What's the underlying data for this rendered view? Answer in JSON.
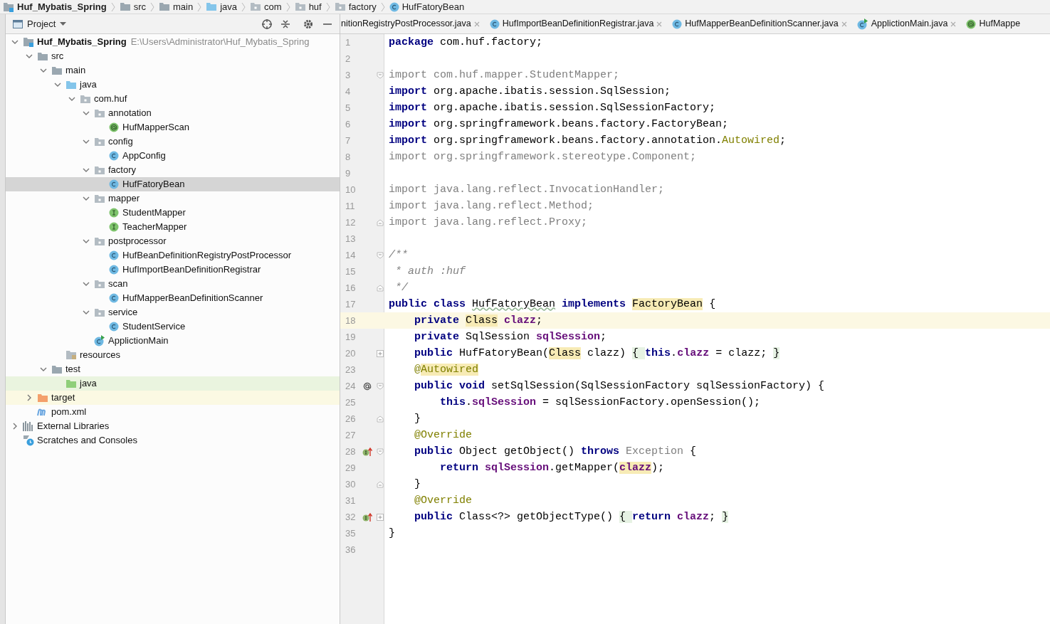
{
  "breadcrumb": [
    {
      "label": "Huf_Mybatis_Spring",
      "kind": "project"
    },
    {
      "label": "src",
      "kind": "folder"
    },
    {
      "label": "main",
      "kind": "folder"
    },
    {
      "label": "java",
      "kind": "src-folder"
    },
    {
      "label": "com",
      "kind": "package"
    },
    {
      "label": "huf",
      "kind": "package"
    },
    {
      "label": "factory",
      "kind": "package"
    },
    {
      "label": "HufFatoryBean",
      "kind": "class"
    }
  ],
  "project_panel": {
    "title": "Project",
    "tree": [
      {
        "label": "Huf_Mybatis_Spring",
        "path": "E:\\Users\\Administrator\\Huf_Mybatis_Spring",
        "kind": "project",
        "expanded": true,
        "selected": false,
        "children": [
          {
            "label": "src",
            "kind": "folder",
            "expanded": true,
            "selected": false,
            "children": [
              {
                "label": "main",
                "kind": "folder",
                "expanded": true,
                "selected": false,
                "children": [
                  {
                    "label": "java",
                    "kind": "src-folder",
                    "expanded": true,
                    "selected": false,
                    "children": [
                      {
                        "label": "com.huf",
                        "kind": "package",
                        "expanded": true,
                        "selected": false,
                        "children": [
                          {
                            "label": "annotation",
                            "kind": "package",
                            "expanded": true,
                            "selected": false,
                            "children": [
                              {
                                "label": "HufMapperScan",
                                "kind": "annotation",
                                "selected": false
                              }
                            ]
                          },
                          {
                            "label": "config",
                            "kind": "package",
                            "expanded": true,
                            "selected": false,
                            "children": [
                              {
                                "label": "AppConfig",
                                "kind": "class",
                                "selected": false
                              }
                            ]
                          },
                          {
                            "label": "factory",
                            "kind": "package",
                            "expanded": true,
                            "selected": false,
                            "children": [
                              {
                                "label": "HufFatoryBean",
                                "kind": "class",
                                "selected": true
                              }
                            ]
                          },
                          {
                            "label": "mapper",
                            "kind": "package",
                            "expanded": true,
                            "selected": false,
                            "children": [
                              {
                                "label": "StudentMapper",
                                "kind": "interface",
                                "selected": false
                              },
                              {
                                "label": "TeacherMapper",
                                "kind": "interface",
                                "selected": false
                              }
                            ]
                          },
                          {
                            "label": "postprocessor",
                            "kind": "package",
                            "expanded": true,
                            "selected": false,
                            "children": [
                              {
                                "label": "HufBeanDefinitionRegistryPostProcessor",
                                "kind": "class",
                                "selected": false
                              },
                              {
                                "label": "HufImportBeanDefinitionRegistrar",
                                "kind": "class",
                                "selected": false
                              }
                            ]
                          },
                          {
                            "label": "scan",
                            "kind": "package",
                            "expanded": true,
                            "selected": false,
                            "children": [
                              {
                                "label": "HufMapperBeanDefinitionScanner",
                                "kind": "class",
                                "selected": false
                              }
                            ]
                          },
                          {
                            "label": "service",
                            "kind": "package",
                            "expanded": true,
                            "selected": false,
                            "children": [
                              {
                                "label": "StudentService",
                                "kind": "class",
                                "selected": false
                              }
                            ]
                          },
                          {
                            "label": "ApplictionMain",
                            "kind": "main-class",
                            "selected": false
                          }
                        ]
                      }
                    ]
                  },
                  {
                    "label": "resources",
                    "kind": "resources",
                    "selected": false
                  }
                ]
              },
              {
                "label": "test",
                "kind": "folder",
                "expanded": true,
                "selected": false,
                "children": [
                  {
                    "label": "java",
                    "kind": "test-folder",
                    "selected": false
                  }
                ]
              }
            ]
          },
          {
            "label": "target",
            "kind": "excluded",
            "expanded": false,
            "selected": false
          },
          {
            "label": "pom.xml",
            "kind": "maven",
            "selected": false
          }
        ]
      },
      {
        "label": "External Libraries",
        "kind": "libraries",
        "expanded": false,
        "selected": false
      },
      {
        "label": "Scratches and Consoles",
        "kind": "scratches",
        "selected": false
      }
    ]
  },
  "tabs": [
    {
      "label": "nitionRegistryPostProcessor.java",
      "kind": "partial",
      "closable": true
    },
    {
      "label": "HufImportBeanDefinitionRegistrar.java",
      "kind": "class",
      "closable": true
    },
    {
      "label": "HufMapperBeanDefinitionScanner.java",
      "kind": "class",
      "closable": true
    },
    {
      "label": "ApplictionMain.java",
      "kind": "main-class",
      "closable": true
    },
    {
      "label": "HufMappe",
      "kind": "annotation",
      "closable": false
    }
  ],
  "editor": {
    "lines": [
      {
        "number": "1",
        "kind": "plain",
        "current": false,
        "tokens": [
          {
            "text": "package",
            "kind": "kw"
          },
          {
            "text": " com.huf.factory;",
            "kind": "plain"
          }
        ]
      },
      {
        "number": "2",
        "kind": "plain",
        "current": false
      },
      {
        "number": "3",
        "kind": "fold-start",
        "current": false,
        "tokens": [
          {
            "text": "import com.huf.mapper.StudentMapper;",
            "kind": "unused"
          }
        ]
      },
      {
        "number": "4",
        "kind": "plain",
        "current": false,
        "tokens": [
          {
            "text": "import",
            "kind": "kw"
          },
          {
            "text": " org.apache.ibatis.session.SqlSession;",
            "kind": "plain"
          }
        ]
      },
      {
        "number": "5",
        "kind": "plain",
        "current": false,
        "tokens": [
          {
            "text": "import",
            "kind": "kw"
          },
          {
            "text": " org.apache.ibatis.session.SqlSessionFactory;",
            "kind": "plain"
          }
        ]
      },
      {
        "number": "6",
        "kind": "plain",
        "current": false,
        "tokens": [
          {
            "text": "import",
            "kind": "kw"
          },
          {
            "text": " org.springframework.beans.factory.FactoryBean;",
            "kind": "plain"
          }
        ]
      },
      {
        "number": "7",
        "kind": "plain",
        "current": false,
        "tokens": [
          {
            "text": "import",
            "kind": "kw"
          },
          {
            "text": " org.springframework.beans.factory.annotation.",
            "kind": "plain"
          },
          {
            "text": "Autowired",
            "kind": "annot"
          },
          {
            "text": ";",
            "kind": "plain"
          }
        ]
      },
      {
        "number": "8",
        "kind": "plain",
        "current": false,
        "tokens": [
          {
            "text": "import org.springframework.stereotype.Component;",
            "kind": "unused"
          }
        ]
      },
      {
        "number": "9",
        "kind": "plain",
        "current": false
      },
      {
        "number": "10",
        "kind": "plain",
        "current": false,
        "tokens": [
          {
            "text": "import java.lang.reflect.InvocationHandler;",
            "kind": "unused"
          }
        ]
      },
      {
        "number": "11",
        "kind": "plain",
        "current": false,
        "tokens": [
          {
            "text": "import java.lang.reflect.Method;",
            "kind": "unused"
          }
        ]
      },
      {
        "number": "12",
        "kind": "fold-end",
        "current": false,
        "tokens": [
          {
            "text": "import java.lang.reflect.Proxy;",
            "kind": "unused"
          }
        ]
      },
      {
        "number": "13",
        "kind": "plain",
        "current": false
      },
      {
        "number": "14",
        "kind": "fold-start",
        "current": false,
        "tokens": [
          {
            "text": "/**",
            "kind": "comment"
          }
        ]
      },
      {
        "number": "15",
        "kind": "plain",
        "current": false,
        "tokens": [
          {
            "text": " * auth :huf",
            "kind": "comment"
          }
        ]
      },
      {
        "number": "16",
        "kind": "fold-end",
        "current": false,
        "tokens": [
          {
            "text": " */",
            "kind": "comment"
          }
        ]
      },
      {
        "number": "17",
        "kind": "plain",
        "current": false,
        "tokens": [
          {
            "text": "public class ",
            "kind": "kw"
          },
          {
            "text": "HufFatoryBean",
            "kind": "typo"
          },
          {
            "text": " implements ",
            "kind": "kw"
          },
          {
            "text": "FactoryBean",
            "kind": "match"
          },
          {
            "text": " {",
            "kind": "plain"
          }
        ]
      },
      {
        "number": "18",
        "kind": "plain",
        "current": true,
        "tokens": [
          {
            "text": "    private ",
            "kind": "kw"
          },
          {
            "text": "Class",
            "kind": "match"
          },
          {
            "text": " clazz",
            "kind": "field"
          },
          {
            "text": ";",
            "kind": "plain"
          }
        ]
      },
      {
        "number": "19",
        "kind": "plain",
        "current": false,
        "tokens": [
          {
            "text": "    private",
            "kind": "kw"
          },
          {
            "text": " SqlSession ",
            "kind": "plain"
          },
          {
            "text": "sqlSession",
            "kind": "field"
          },
          {
            "text": ";",
            "kind": "plain"
          }
        ]
      },
      {
        "number": "20",
        "kind": "fold-collapsed",
        "current": false,
        "tokens": [
          {
            "text": "    public",
            "kind": "kw"
          },
          {
            "text": " HufFatoryBean(",
            "kind": "plain"
          },
          {
            "text": "Class",
            "kind": "match"
          },
          {
            "text": " clazz) ",
            "kind": "plain"
          },
          {
            "text": "{ ",
            "kind": "folded"
          },
          {
            "text": "this",
            "kind": "kw"
          },
          {
            "text": ".",
            "kind": "plain"
          },
          {
            "text": "clazz",
            "kind": "field"
          },
          {
            "text": " = clazz; ",
            "kind": "plain"
          },
          {
            "text": "}",
            "kind": "folded"
          }
        ]
      },
      {
        "number": "23",
        "kind": "plain",
        "current": false,
        "tokens": [
          {
            "text": "    @",
            "kind": "annot"
          },
          {
            "text": "Autowired",
            "kind": "match-annot"
          }
        ]
      },
      {
        "number": "24",
        "kind": "implements-fold-start",
        "current": false,
        "tokens": [
          {
            "text": "    public void",
            "kind": "kw"
          },
          {
            "text": " setSqlSession(SqlSessionFactory sqlSessionFactory) {",
            "kind": "plain"
          }
        ]
      },
      {
        "number": "25",
        "kind": "plain",
        "current": false,
        "tokens": [
          {
            "text": "        this",
            "kind": "kw"
          },
          {
            "text": ".",
            "kind": "plain"
          },
          {
            "text": "sqlSession",
            "kind": "field"
          },
          {
            "text": " = sqlSessionFactory.openSession();",
            "kind": "plain"
          }
        ]
      },
      {
        "number": "26",
        "kind": "fold-end",
        "current": false,
        "tokens": [
          {
            "text": "    }",
            "kind": "plain"
          }
        ]
      },
      {
        "number": "27",
        "kind": "plain",
        "current": false,
        "tokens": [
          {
            "text": "    @Override",
            "kind": "annot"
          }
        ]
      },
      {
        "number": "28",
        "kind": "override-fold-start",
        "current": false,
        "tokens": [
          {
            "text": "    public",
            "kind": "kw"
          },
          {
            "text": " Object getObject() ",
            "kind": "plain"
          },
          {
            "text": "throws ",
            "kind": "kw"
          },
          {
            "text": "Exception",
            "kind": "unused"
          },
          {
            "text": " {",
            "kind": "plain"
          }
        ]
      },
      {
        "number": "29",
        "kind": "plain",
        "current": false,
        "tokens": [
          {
            "text": "        return ",
            "kind": "kw"
          },
          {
            "text": "sqlSession",
            "kind": "field"
          },
          {
            "text": ".getMapper(",
            "kind": "plain"
          },
          {
            "text": "clazz",
            "kind": "match-field"
          },
          {
            "text": ");",
            "kind": "plain"
          }
        ]
      },
      {
        "number": "30",
        "kind": "fold-end",
        "current": false,
        "tokens": [
          {
            "text": "    }",
            "kind": "plain"
          }
        ]
      },
      {
        "number": "31",
        "kind": "plain",
        "current": false,
        "tokens": [
          {
            "text": "    @Override",
            "kind": "annot"
          }
        ]
      },
      {
        "number": "32",
        "kind": "override-fold-collapsed",
        "current": false,
        "tokens": [
          {
            "text": "    public",
            "kind": "kw"
          },
          {
            "text": " Class<?> getObjectType() ",
            "kind": "plain"
          },
          {
            "text": "{ ",
            "kind": "folded"
          },
          {
            "text": "return ",
            "kind": "kw"
          },
          {
            "text": "clazz",
            "kind": "field"
          },
          {
            "text": "; ",
            "kind": "plain"
          },
          {
            "text": "}",
            "kind": "folded"
          }
        ]
      },
      {
        "number": "35",
        "kind": "plain",
        "current": false,
        "tokens": [
          {
            "text": "}",
            "kind": "plain"
          }
        ]
      },
      {
        "number": "36",
        "kind": "plain",
        "current": false
      }
    ]
  }
}
